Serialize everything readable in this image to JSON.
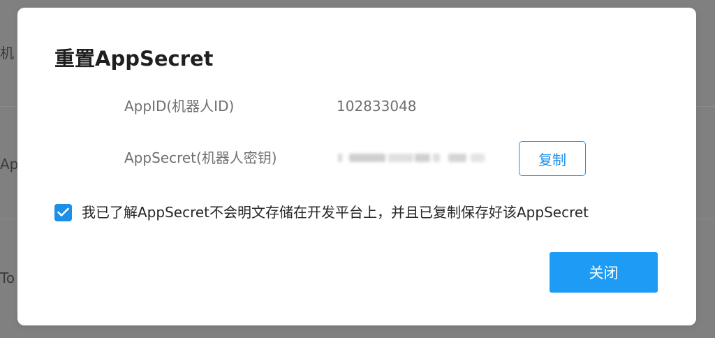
{
  "background": {
    "text_1": "机",
    "text_2": "Ap",
    "text_3": "To"
  },
  "dialog": {
    "title": "重置AppSecret",
    "appid_label": "AppID(机器人ID)",
    "appid_value": "102833048",
    "secret_label": "AppSecret(机器人密钥)",
    "copy_label": "复制",
    "ack_checked": true,
    "ack_text": "我已了解AppSecret不会明文存储在开发平台上，并且已复制保存好该AppSecret",
    "close_label": "关闭"
  },
  "colors": {
    "accent": "#1d8fe6",
    "primary_button": "#1d9bf5",
    "overlay": "#808080"
  },
  "icons": {
    "checkbox_mark": "check-icon"
  }
}
